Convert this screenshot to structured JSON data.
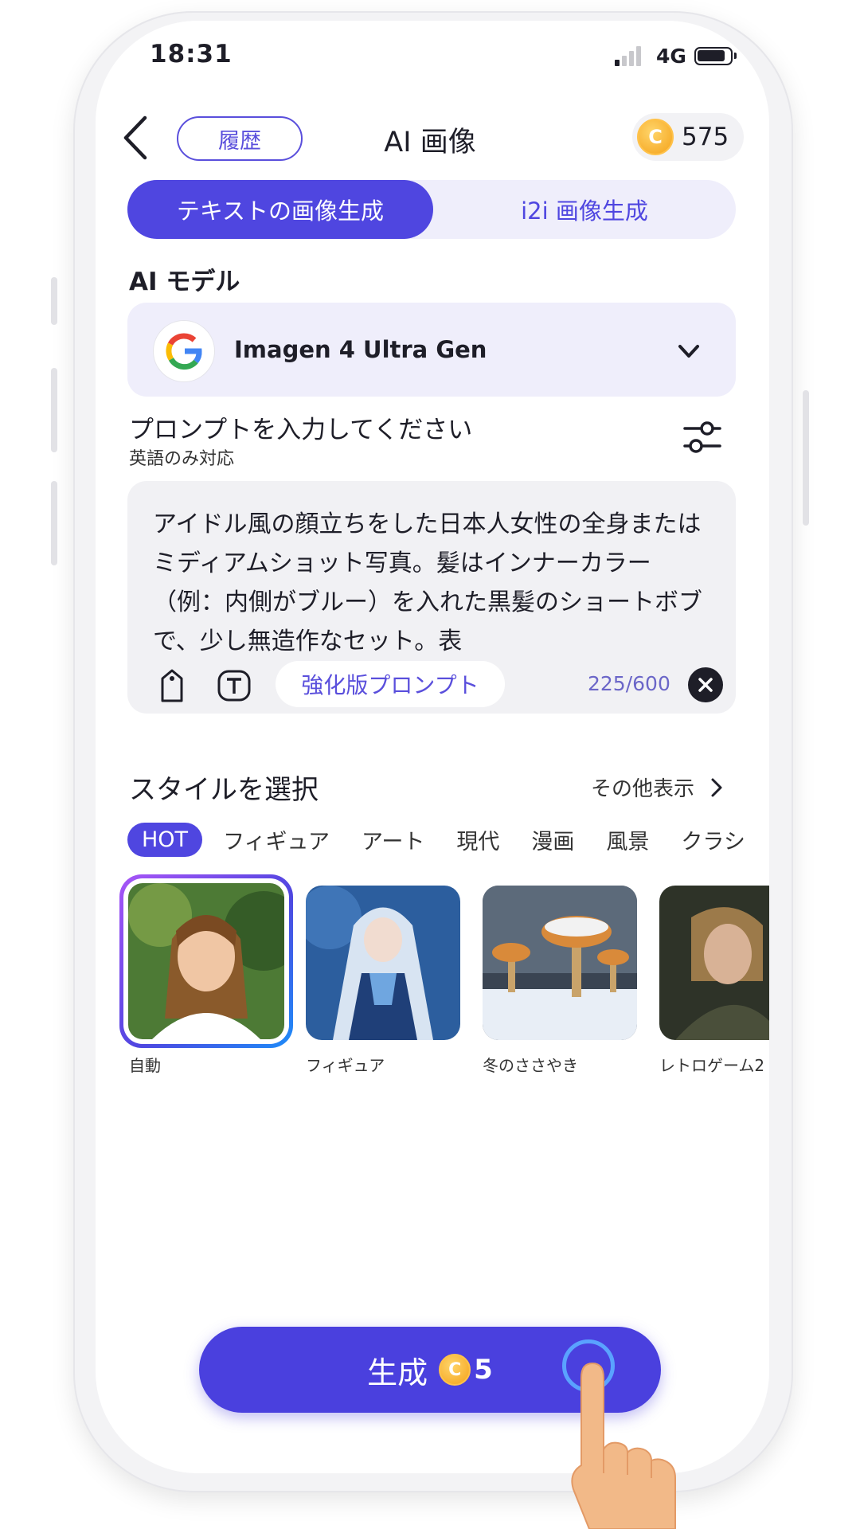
{
  "status_bar": {
    "time": "18:31",
    "network": "4G"
  },
  "header": {
    "history_label": "履歴",
    "title": "AI 画像",
    "coin_count": "575",
    "coin_glyph": "C"
  },
  "mode_tabs": [
    {
      "label": "テキストの画像生成",
      "active": true
    },
    {
      "label": "i2i 画像生成",
      "active": false
    }
  ],
  "model": {
    "section_label": "AI モデル",
    "selected": "Imagen 4 Ultra Gen",
    "icon": "google-logo-icon"
  },
  "prompt": {
    "label": "プロンプトを入力してください",
    "sublabel": "英語のみ対応",
    "text": "アイドル風の顔立ちをした日本人女性の全身またはミディアムショット写真。髪はインナーカラー（例：内側がブルー）を入れた黒髪のショートボブで、少し無造作なセット。表",
    "enhance_label": "強化版プロンプト",
    "counter": "225/600"
  },
  "styles": {
    "title": "スタイルを選択",
    "more_label": "その他表示",
    "categories": [
      "HOT",
      "フィギュア",
      "アート",
      "現代",
      "漫画",
      "風景",
      "クラシ"
    ],
    "items": [
      {
        "label": "自動",
        "selected": true
      },
      {
        "label": "フィギュア",
        "selected": false
      },
      {
        "label": "冬のささやき",
        "selected": false
      },
      {
        "label": "レトロゲーム2",
        "selected": false
      }
    ]
  },
  "generate": {
    "label": "生成",
    "cost": "5",
    "coin_glyph": "C"
  },
  "colors": {
    "accent": "#4f46e0",
    "coin": "#f4a21a",
    "panel": "#efeefb"
  }
}
